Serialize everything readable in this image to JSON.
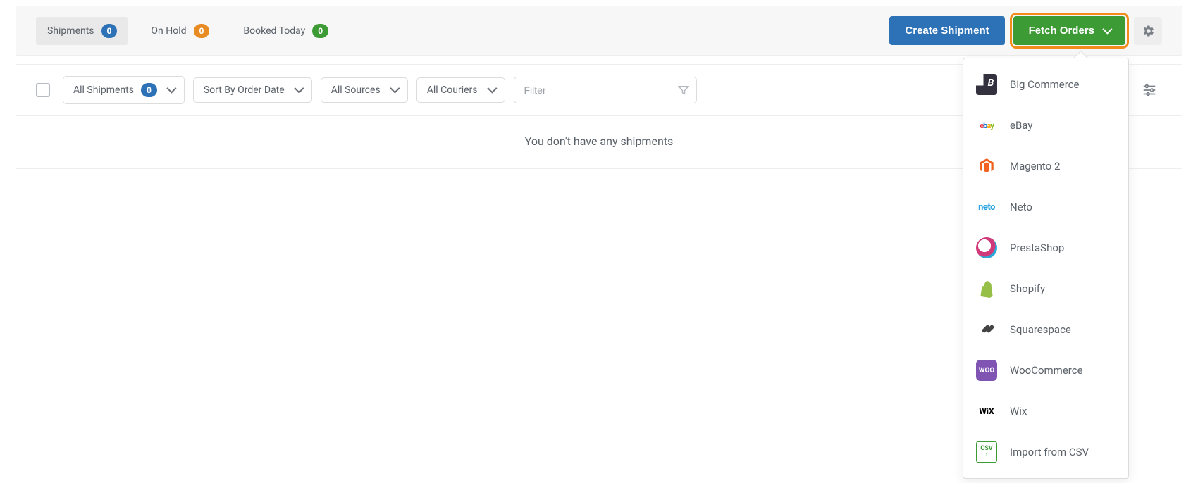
{
  "tabs": {
    "shipments": {
      "label": "Shipments",
      "count": "0"
    },
    "onhold": {
      "label": "On Hold",
      "count": "0"
    },
    "booked": {
      "label": "Booked Today",
      "count": "0"
    }
  },
  "buttons": {
    "create_shipment": "Create Shipment",
    "fetch_orders": "Fetch Orders"
  },
  "filters": {
    "all_shipments": {
      "label": "All Shipments",
      "count": "0"
    },
    "sort": "Sort By Order Date",
    "sources": "All Sources",
    "couriers": "All Couriers",
    "filter_placeholder": "Filter"
  },
  "empty_message": "You don't have any shipments",
  "fetch_menu": [
    {
      "label": "Big Commerce"
    },
    {
      "label": "eBay"
    },
    {
      "label": "Magento 2"
    },
    {
      "label": "Neto"
    },
    {
      "label": "PrestaShop"
    },
    {
      "label": "Shopify"
    },
    {
      "label": "Squarespace"
    },
    {
      "label": "WooCommerce"
    },
    {
      "label": "Wix"
    },
    {
      "label": "Import from CSV"
    }
  ]
}
